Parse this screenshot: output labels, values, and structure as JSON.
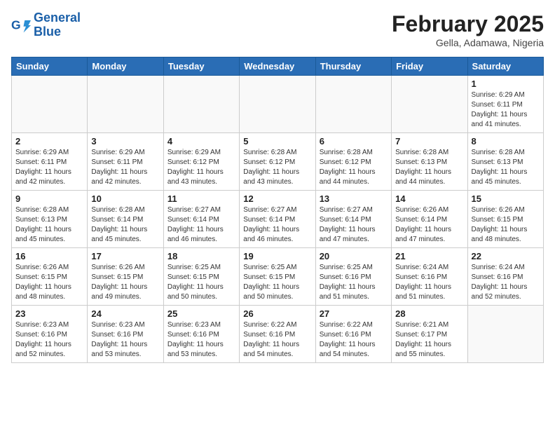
{
  "header": {
    "logo_line1": "General",
    "logo_line2": "Blue",
    "month": "February 2025",
    "location": "Gella, Adamawa, Nigeria"
  },
  "weekdays": [
    "Sunday",
    "Monday",
    "Tuesday",
    "Wednesday",
    "Thursday",
    "Friday",
    "Saturday"
  ],
  "weeks": [
    [
      {
        "day": "",
        "info": ""
      },
      {
        "day": "",
        "info": ""
      },
      {
        "day": "",
        "info": ""
      },
      {
        "day": "",
        "info": ""
      },
      {
        "day": "",
        "info": ""
      },
      {
        "day": "",
        "info": ""
      },
      {
        "day": "1",
        "info": "Sunrise: 6:29 AM\nSunset: 6:11 PM\nDaylight: 11 hours and 41 minutes."
      }
    ],
    [
      {
        "day": "2",
        "info": "Sunrise: 6:29 AM\nSunset: 6:11 PM\nDaylight: 11 hours and 42 minutes."
      },
      {
        "day": "3",
        "info": "Sunrise: 6:29 AM\nSunset: 6:11 PM\nDaylight: 11 hours and 42 minutes."
      },
      {
        "day": "4",
        "info": "Sunrise: 6:29 AM\nSunset: 6:12 PM\nDaylight: 11 hours and 43 minutes."
      },
      {
        "day": "5",
        "info": "Sunrise: 6:28 AM\nSunset: 6:12 PM\nDaylight: 11 hours and 43 minutes."
      },
      {
        "day": "6",
        "info": "Sunrise: 6:28 AM\nSunset: 6:12 PM\nDaylight: 11 hours and 44 minutes."
      },
      {
        "day": "7",
        "info": "Sunrise: 6:28 AM\nSunset: 6:13 PM\nDaylight: 11 hours and 44 minutes."
      },
      {
        "day": "8",
        "info": "Sunrise: 6:28 AM\nSunset: 6:13 PM\nDaylight: 11 hours and 45 minutes."
      }
    ],
    [
      {
        "day": "9",
        "info": "Sunrise: 6:28 AM\nSunset: 6:13 PM\nDaylight: 11 hours and 45 minutes."
      },
      {
        "day": "10",
        "info": "Sunrise: 6:28 AM\nSunset: 6:14 PM\nDaylight: 11 hours and 45 minutes."
      },
      {
        "day": "11",
        "info": "Sunrise: 6:27 AM\nSunset: 6:14 PM\nDaylight: 11 hours and 46 minutes."
      },
      {
        "day": "12",
        "info": "Sunrise: 6:27 AM\nSunset: 6:14 PM\nDaylight: 11 hours and 46 minutes."
      },
      {
        "day": "13",
        "info": "Sunrise: 6:27 AM\nSunset: 6:14 PM\nDaylight: 11 hours and 47 minutes."
      },
      {
        "day": "14",
        "info": "Sunrise: 6:26 AM\nSunset: 6:14 PM\nDaylight: 11 hours and 47 minutes."
      },
      {
        "day": "15",
        "info": "Sunrise: 6:26 AM\nSunset: 6:15 PM\nDaylight: 11 hours and 48 minutes."
      }
    ],
    [
      {
        "day": "16",
        "info": "Sunrise: 6:26 AM\nSunset: 6:15 PM\nDaylight: 11 hours and 48 minutes."
      },
      {
        "day": "17",
        "info": "Sunrise: 6:26 AM\nSunset: 6:15 PM\nDaylight: 11 hours and 49 minutes."
      },
      {
        "day": "18",
        "info": "Sunrise: 6:25 AM\nSunset: 6:15 PM\nDaylight: 11 hours and 50 minutes."
      },
      {
        "day": "19",
        "info": "Sunrise: 6:25 AM\nSunset: 6:15 PM\nDaylight: 11 hours and 50 minutes."
      },
      {
        "day": "20",
        "info": "Sunrise: 6:25 AM\nSunset: 6:16 PM\nDaylight: 11 hours and 51 minutes."
      },
      {
        "day": "21",
        "info": "Sunrise: 6:24 AM\nSunset: 6:16 PM\nDaylight: 11 hours and 51 minutes."
      },
      {
        "day": "22",
        "info": "Sunrise: 6:24 AM\nSunset: 6:16 PM\nDaylight: 11 hours and 52 minutes."
      }
    ],
    [
      {
        "day": "23",
        "info": "Sunrise: 6:23 AM\nSunset: 6:16 PM\nDaylight: 11 hours and 52 minutes."
      },
      {
        "day": "24",
        "info": "Sunrise: 6:23 AM\nSunset: 6:16 PM\nDaylight: 11 hours and 53 minutes."
      },
      {
        "day": "25",
        "info": "Sunrise: 6:23 AM\nSunset: 6:16 PM\nDaylight: 11 hours and 53 minutes."
      },
      {
        "day": "26",
        "info": "Sunrise: 6:22 AM\nSunset: 6:16 PM\nDaylight: 11 hours and 54 minutes."
      },
      {
        "day": "27",
        "info": "Sunrise: 6:22 AM\nSunset: 6:16 PM\nDaylight: 11 hours and 54 minutes."
      },
      {
        "day": "28",
        "info": "Sunrise: 6:21 AM\nSunset: 6:17 PM\nDaylight: 11 hours and 55 minutes."
      },
      {
        "day": "",
        "info": ""
      }
    ]
  ]
}
